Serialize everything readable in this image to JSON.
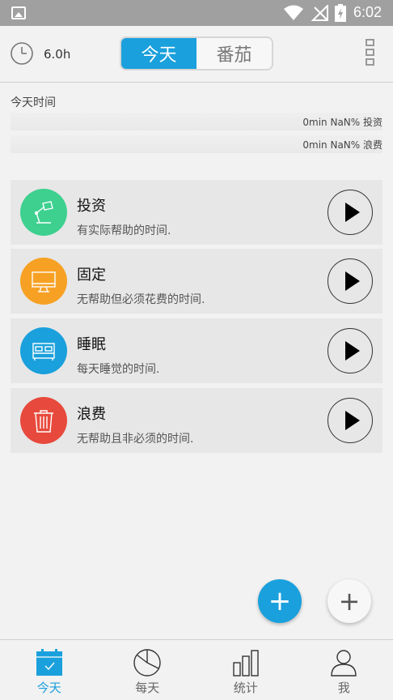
{
  "status": {
    "time": "6:02"
  },
  "header": {
    "duration": "6.0h",
    "tabs": [
      {
        "label": "今天",
        "active": true
      },
      {
        "label": "番茄",
        "active": false
      }
    ]
  },
  "summary": {
    "title": "今天时间",
    "rows": [
      "0min NaN% 投资",
      "0min NaN% 浪费"
    ]
  },
  "categories": [
    {
      "name": "投资",
      "desc": "有实际帮助的时间.",
      "color": "#3dd08f",
      "icon": "lamp-icon"
    },
    {
      "name": "固定",
      "desc": "无帮助但必须花费的时间.",
      "color": "#f7a124",
      "icon": "monitor-icon"
    },
    {
      "name": "睡眠",
      "desc": "每天睡觉的时间.",
      "color": "#1aa0dc",
      "icon": "bed-icon"
    },
    {
      "name": "浪费",
      "desc": "无帮助且非必须的时间.",
      "color": "#e74a3c",
      "icon": "trash-icon"
    }
  ],
  "fab": {
    "main": "+",
    "secondary": "+"
  },
  "nav": [
    {
      "label": "今天",
      "icon": "calendar-icon",
      "active": true
    },
    {
      "label": "每天",
      "icon": "pie-chart-icon",
      "active": false
    },
    {
      "label": "统计",
      "icon": "bar-chart-icon",
      "active": false
    },
    {
      "label": "我",
      "icon": "user-icon",
      "active": false
    }
  ],
  "colors": {
    "accent": "#1aa0dc",
    "statusbar": "#a0a0a0"
  }
}
